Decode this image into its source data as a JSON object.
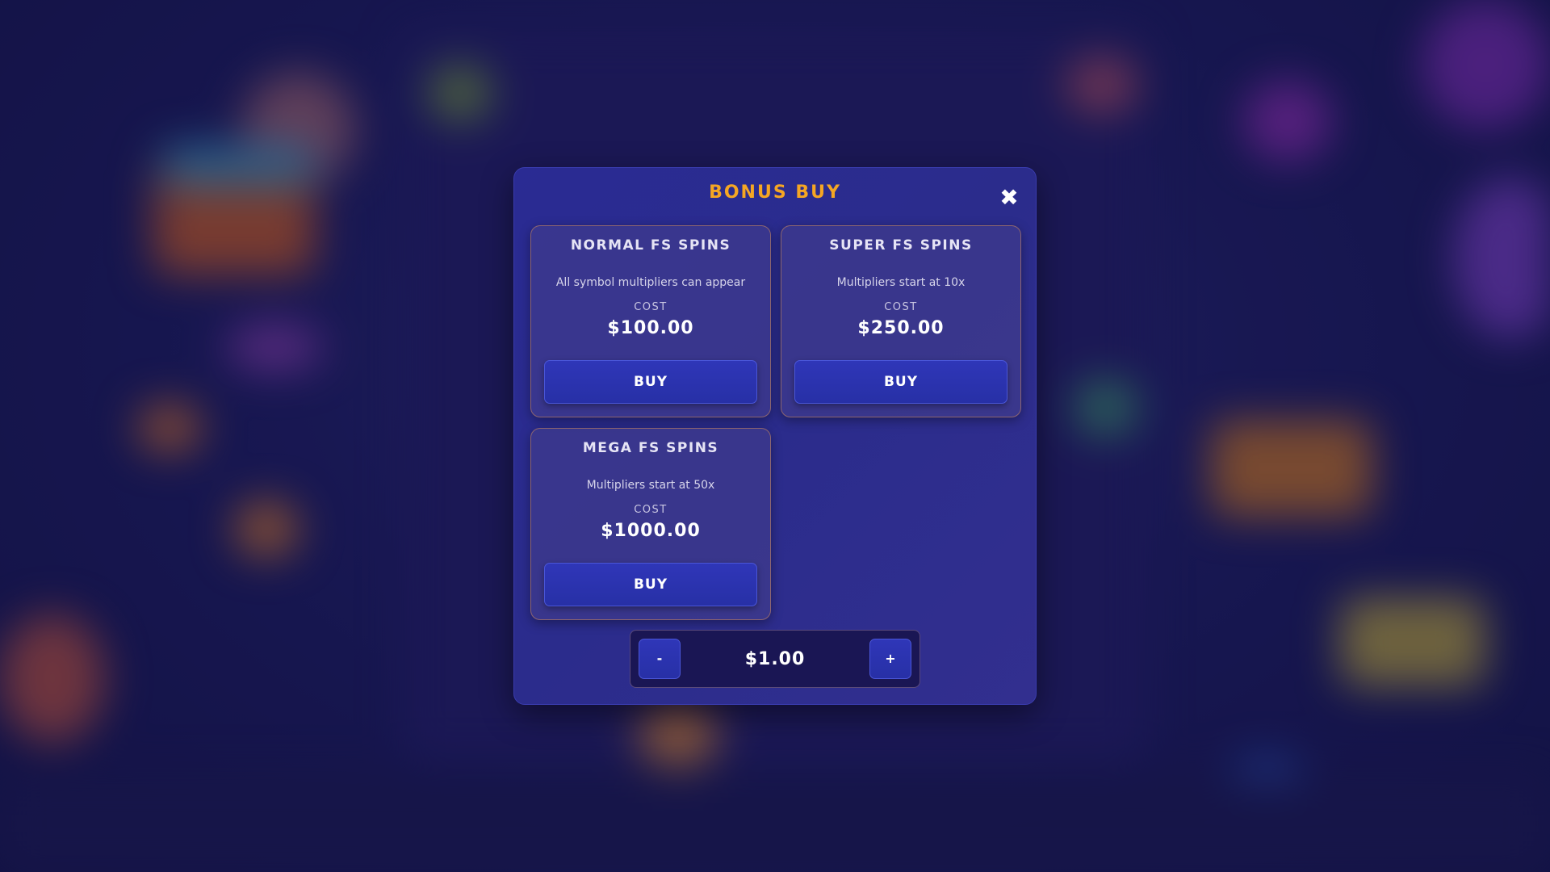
{
  "colors": {
    "accent": "#f5a623",
    "modal_bg": "#2a2b93",
    "button_bg": "#2f36b8",
    "card_border": "#d28c5a"
  },
  "modal": {
    "title": "BONUS BUY",
    "close_icon": "close-icon"
  },
  "cards": [
    {
      "title": "NORMAL FS SPINS",
      "description": "All symbol multipliers can appear",
      "cost_label": "COST",
      "price": "$100.00",
      "buy_label": "BUY"
    },
    {
      "title": "SUPER FS SPINS",
      "description": "Multipliers start at 10x",
      "cost_label": "COST",
      "price": "$250.00",
      "buy_label": "BUY"
    },
    {
      "title": "MEGA FS SPINS",
      "description": "Multipliers start at 50x",
      "cost_label": "COST",
      "price": "$1000.00",
      "buy_label": "BUY"
    }
  ],
  "bet": {
    "minus_label": "-",
    "value": "$1.00",
    "plus_label": "+"
  }
}
